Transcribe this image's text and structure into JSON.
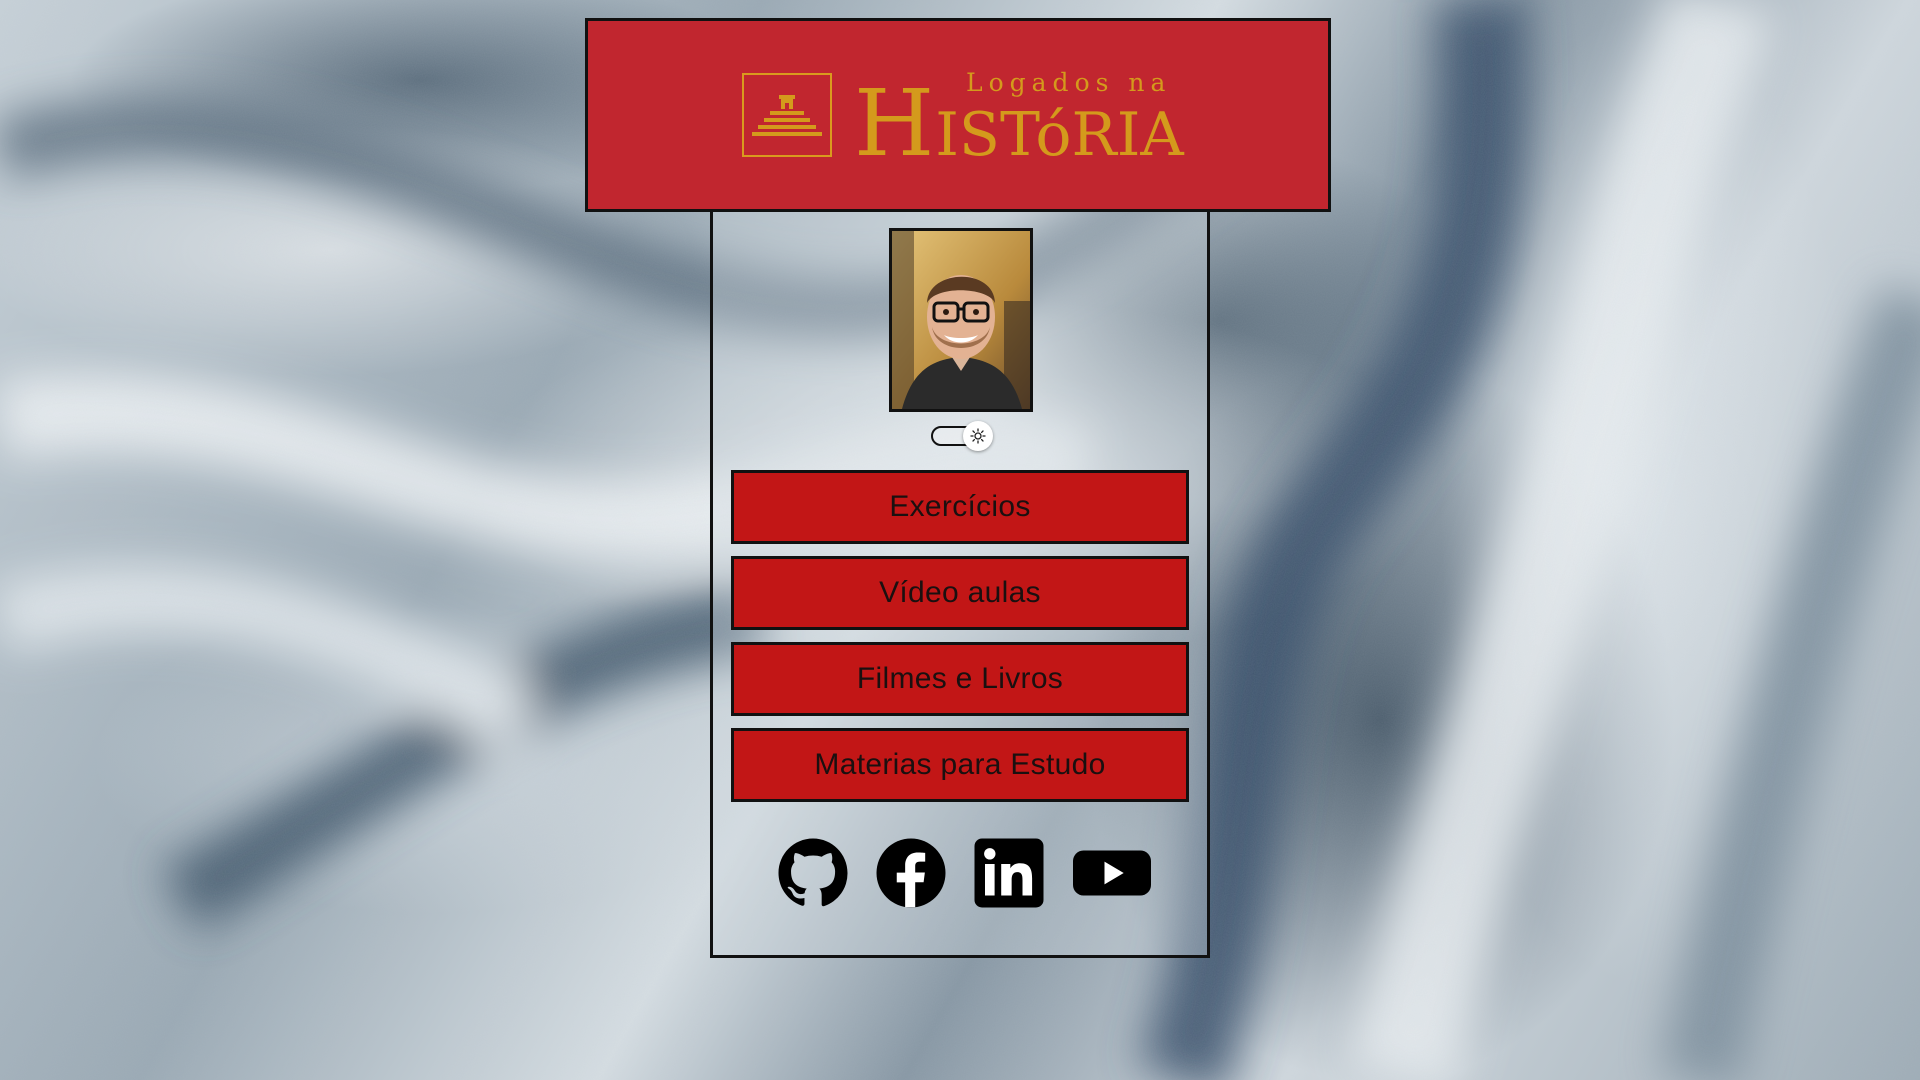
{
  "header": {
    "logo_small": "Logados na",
    "logo_big_initial": "H",
    "logo_big_rest": "ISTóRIA",
    "logo_icon": "pyramid-icon",
    "bg_color": "#c1262f",
    "logo_color": "#d49a1c"
  },
  "profile": {
    "avatar_icon": "profile-photo",
    "theme_toggle_icon": "sun-icon"
  },
  "menu": {
    "items": [
      {
        "label": "Exercícios"
      },
      {
        "label": "Vídeo aulas"
      },
      {
        "label": "Filmes e Livros"
      },
      {
        "label": "Materias para Estudo"
      }
    ],
    "button_color": "#c21616"
  },
  "socials": {
    "items": [
      {
        "icon": "github-icon"
      },
      {
        "icon": "facebook-icon"
      },
      {
        "icon": "linkedin-icon"
      },
      {
        "icon": "youtube-icon"
      }
    ]
  }
}
